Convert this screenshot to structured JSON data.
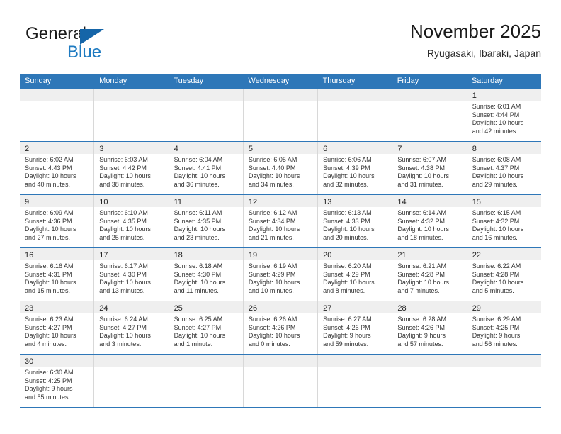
{
  "brand": {
    "name_part1": "General",
    "name_part2": "Blue",
    "accent_color": "#1f7bc1",
    "triangle_color": "#1565a8"
  },
  "header": {
    "title": "November 2025",
    "subtitle": "Ryugasaki, Ibaraki, Japan",
    "header_bg_color": "#2e77b8",
    "daynum_band_color": "#efefef"
  },
  "weekdays": [
    "Sunday",
    "Monday",
    "Tuesday",
    "Wednesday",
    "Thursday",
    "Friday",
    "Saturday"
  ],
  "weeks": [
    [
      {
        "day": "",
        "sunrise": "",
        "sunset": "",
        "daylight1": "",
        "daylight2": ""
      },
      {
        "day": "",
        "sunrise": "",
        "sunset": "",
        "daylight1": "",
        "daylight2": ""
      },
      {
        "day": "",
        "sunrise": "",
        "sunset": "",
        "daylight1": "",
        "daylight2": ""
      },
      {
        "day": "",
        "sunrise": "",
        "sunset": "",
        "daylight1": "",
        "daylight2": ""
      },
      {
        "day": "",
        "sunrise": "",
        "sunset": "",
        "daylight1": "",
        "daylight2": ""
      },
      {
        "day": "",
        "sunrise": "",
        "sunset": "",
        "daylight1": "",
        "daylight2": ""
      },
      {
        "day": "1",
        "sunrise": "Sunrise: 6:01 AM",
        "sunset": "Sunset: 4:44 PM",
        "daylight1": "Daylight: 10 hours",
        "daylight2": "and 42 minutes."
      }
    ],
    [
      {
        "day": "2",
        "sunrise": "Sunrise: 6:02 AM",
        "sunset": "Sunset: 4:43 PM",
        "daylight1": "Daylight: 10 hours",
        "daylight2": "and 40 minutes."
      },
      {
        "day": "3",
        "sunrise": "Sunrise: 6:03 AM",
        "sunset": "Sunset: 4:42 PM",
        "daylight1": "Daylight: 10 hours",
        "daylight2": "and 38 minutes."
      },
      {
        "day": "4",
        "sunrise": "Sunrise: 6:04 AM",
        "sunset": "Sunset: 4:41 PM",
        "daylight1": "Daylight: 10 hours",
        "daylight2": "and 36 minutes."
      },
      {
        "day": "5",
        "sunrise": "Sunrise: 6:05 AM",
        "sunset": "Sunset: 4:40 PM",
        "daylight1": "Daylight: 10 hours",
        "daylight2": "and 34 minutes."
      },
      {
        "day": "6",
        "sunrise": "Sunrise: 6:06 AM",
        "sunset": "Sunset: 4:39 PM",
        "daylight1": "Daylight: 10 hours",
        "daylight2": "and 32 minutes."
      },
      {
        "day": "7",
        "sunrise": "Sunrise: 6:07 AM",
        "sunset": "Sunset: 4:38 PM",
        "daylight1": "Daylight: 10 hours",
        "daylight2": "and 31 minutes."
      },
      {
        "day": "8",
        "sunrise": "Sunrise: 6:08 AM",
        "sunset": "Sunset: 4:37 PM",
        "daylight1": "Daylight: 10 hours",
        "daylight2": "and 29 minutes."
      }
    ],
    [
      {
        "day": "9",
        "sunrise": "Sunrise: 6:09 AM",
        "sunset": "Sunset: 4:36 PM",
        "daylight1": "Daylight: 10 hours",
        "daylight2": "and 27 minutes."
      },
      {
        "day": "10",
        "sunrise": "Sunrise: 6:10 AM",
        "sunset": "Sunset: 4:35 PM",
        "daylight1": "Daylight: 10 hours",
        "daylight2": "and 25 minutes."
      },
      {
        "day": "11",
        "sunrise": "Sunrise: 6:11 AM",
        "sunset": "Sunset: 4:35 PM",
        "daylight1": "Daylight: 10 hours",
        "daylight2": "and 23 minutes."
      },
      {
        "day": "12",
        "sunrise": "Sunrise: 6:12 AM",
        "sunset": "Sunset: 4:34 PM",
        "daylight1": "Daylight: 10 hours",
        "daylight2": "and 21 minutes."
      },
      {
        "day": "13",
        "sunrise": "Sunrise: 6:13 AM",
        "sunset": "Sunset: 4:33 PM",
        "daylight1": "Daylight: 10 hours",
        "daylight2": "and 20 minutes."
      },
      {
        "day": "14",
        "sunrise": "Sunrise: 6:14 AM",
        "sunset": "Sunset: 4:32 PM",
        "daylight1": "Daylight: 10 hours",
        "daylight2": "and 18 minutes."
      },
      {
        "day": "15",
        "sunrise": "Sunrise: 6:15 AM",
        "sunset": "Sunset: 4:32 PM",
        "daylight1": "Daylight: 10 hours",
        "daylight2": "and 16 minutes."
      }
    ],
    [
      {
        "day": "16",
        "sunrise": "Sunrise: 6:16 AM",
        "sunset": "Sunset: 4:31 PM",
        "daylight1": "Daylight: 10 hours",
        "daylight2": "and 15 minutes."
      },
      {
        "day": "17",
        "sunrise": "Sunrise: 6:17 AM",
        "sunset": "Sunset: 4:30 PM",
        "daylight1": "Daylight: 10 hours",
        "daylight2": "and 13 minutes."
      },
      {
        "day": "18",
        "sunrise": "Sunrise: 6:18 AM",
        "sunset": "Sunset: 4:30 PM",
        "daylight1": "Daylight: 10 hours",
        "daylight2": "and 11 minutes."
      },
      {
        "day": "19",
        "sunrise": "Sunrise: 6:19 AM",
        "sunset": "Sunset: 4:29 PM",
        "daylight1": "Daylight: 10 hours",
        "daylight2": "and 10 minutes."
      },
      {
        "day": "20",
        "sunrise": "Sunrise: 6:20 AM",
        "sunset": "Sunset: 4:29 PM",
        "daylight1": "Daylight: 10 hours",
        "daylight2": "and 8 minutes."
      },
      {
        "day": "21",
        "sunrise": "Sunrise: 6:21 AM",
        "sunset": "Sunset: 4:28 PM",
        "daylight1": "Daylight: 10 hours",
        "daylight2": "and 7 minutes."
      },
      {
        "day": "22",
        "sunrise": "Sunrise: 6:22 AM",
        "sunset": "Sunset: 4:28 PM",
        "daylight1": "Daylight: 10 hours",
        "daylight2": "and 5 minutes."
      }
    ],
    [
      {
        "day": "23",
        "sunrise": "Sunrise: 6:23 AM",
        "sunset": "Sunset: 4:27 PM",
        "daylight1": "Daylight: 10 hours",
        "daylight2": "and 4 minutes."
      },
      {
        "day": "24",
        "sunrise": "Sunrise: 6:24 AM",
        "sunset": "Sunset: 4:27 PM",
        "daylight1": "Daylight: 10 hours",
        "daylight2": "and 3 minutes."
      },
      {
        "day": "25",
        "sunrise": "Sunrise: 6:25 AM",
        "sunset": "Sunset: 4:27 PM",
        "daylight1": "Daylight: 10 hours",
        "daylight2": "and 1 minute."
      },
      {
        "day": "26",
        "sunrise": "Sunrise: 6:26 AM",
        "sunset": "Sunset: 4:26 PM",
        "daylight1": "Daylight: 10 hours",
        "daylight2": "and 0 minutes."
      },
      {
        "day": "27",
        "sunrise": "Sunrise: 6:27 AM",
        "sunset": "Sunset: 4:26 PM",
        "daylight1": "Daylight: 9 hours",
        "daylight2": "and 59 minutes."
      },
      {
        "day": "28",
        "sunrise": "Sunrise: 6:28 AM",
        "sunset": "Sunset: 4:26 PM",
        "daylight1": "Daylight: 9 hours",
        "daylight2": "and 57 minutes."
      },
      {
        "day": "29",
        "sunrise": "Sunrise: 6:29 AM",
        "sunset": "Sunset: 4:25 PM",
        "daylight1": "Daylight: 9 hours",
        "daylight2": "and 56 minutes."
      }
    ],
    [
      {
        "day": "30",
        "sunrise": "Sunrise: 6:30 AM",
        "sunset": "Sunset: 4:25 PM",
        "daylight1": "Daylight: 9 hours",
        "daylight2": "and 55 minutes."
      },
      {
        "day": "",
        "sunrise": "",
        "sunset": "",
        "daylight1": "",
        "daylight2": ""
      },
      {
        "day": "",
        "sunrise": "",
        "sunset": "",
        "daylight1": "",
        "daylight2": ""
      },
      {
        "day": "",
        "sunrise": "",
        "sunset": "",
        "daylight1": "",
        "daylight2": ""
      },
      {
        "day": "",
        "sunrise": "",
        "sunset": "",
        "daylight1": "",
        "daylight2": ""
      },
      {
        "day": "",
        "sunrise": "",
        "sunset": "",
        "daylight1": "",
        "daylight2": ""
      },
      {
        "day": "",
        "sunrise": "",
        "sunset": "",
        "daylight1": "",
        "daylight2": ""
      }
    ]
  ]
}
